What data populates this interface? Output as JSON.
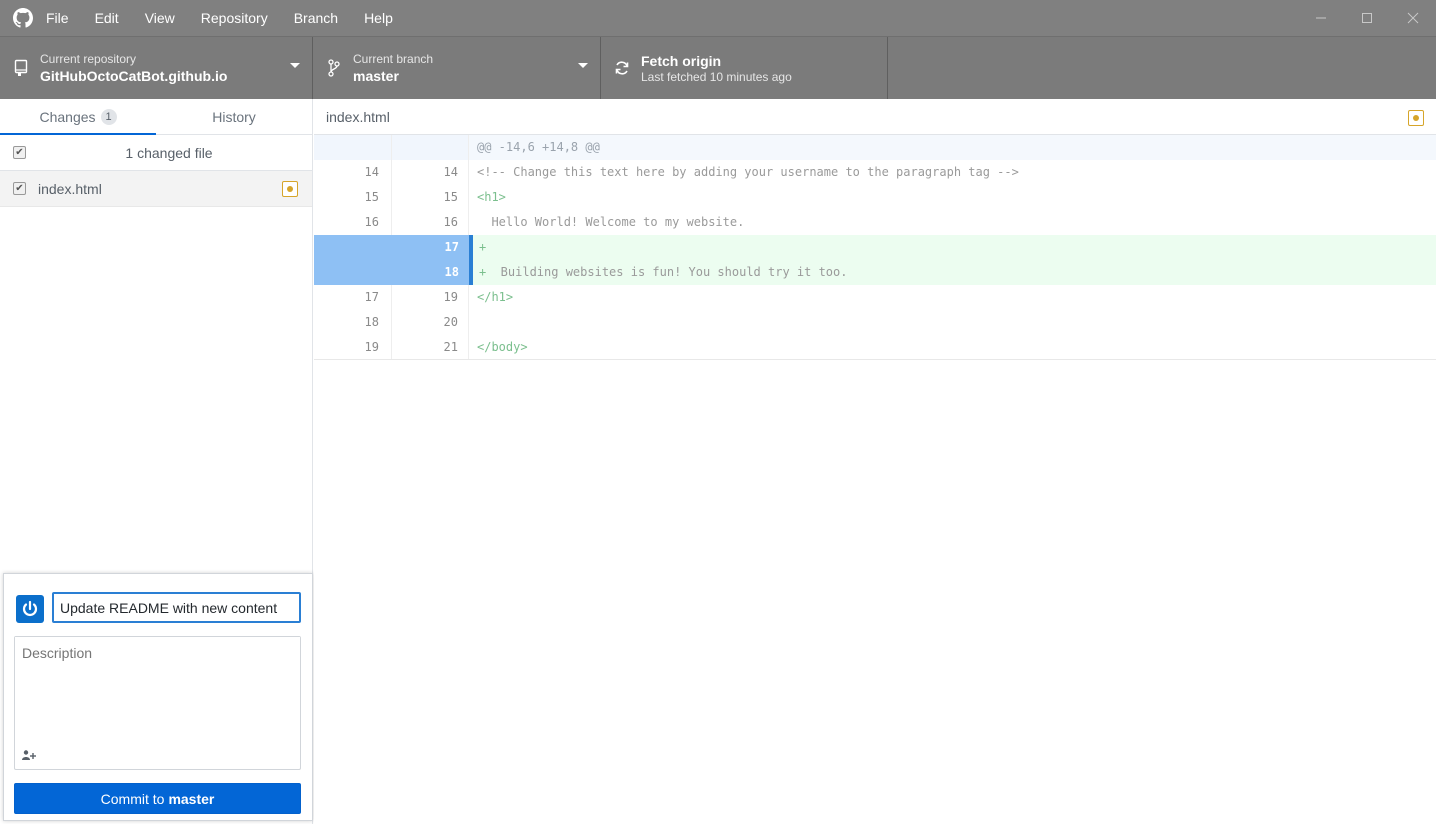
{
  "titlebar": {
    "menu": [
      "File",
      "Edit",
      "View",
      "Repository",
      "Branch",
      "Help"
    ],
    "colors": {
      "background": "#808080"
    }
  },
  "toolbar": {
    "repository": {
      "label": "Current repository",
      "value": "GitHubOctoCatBot.github.io",
      "icon": "repo-icon"
    },
    "branch": {
      "label": "Current branch",
      "value": "master",
      "icon": "branch-icon"
    },
    "fetch": {
      "title": "Fetch origin",
      "subtitle": "Last fetched 10 minutes ago",
      "icon": "sync-icon"
    }
  },
  "sidebar": {
    "tabs": {
      "changes": "Changes",
      "changes_count": "1",
      "history": "History"
    },
    "changed_files_header": "1 changed file",
    "files": [
      {
        "name": "index.html",
        "status": "modified"
      }
    ]
  },
  "commit": {
    "summary_value": "Update README with new content",
    "description_placeholder": "Description",
    "button_prefix": "Commit to",
    "button_branch": "master",
    "accent": "#0366d6"
  },
  "diff": {
    "filename": "index.html",
    "hunk_header": "@@ -14,6 +14,8 @@",
    "lines": [
      {
        "old": "14",
        "new": "14",
        "type": "context",
        "text": "<!-- Change this text here by adding your username to the paragraph tag -->"
      },
      {
        "old": "15",
        "new": "15",
        "type": "context",
        "text": "<h1>"
      },
      {
        "old": "16",
        "new": "16",
        "type": "context",
        "text": "  Hello World! Welcome to my website."
      },
      {
        "old": "",
        "new": "17",
        "type": "add",
        "text": ""
      },
      {
        "old": "",
        "new": "18",
        "type": "add",
        "text": "  Building websites is fun! You should try it too."
      },
      {
        "old": "17",
        "new": "19",
        "type": "context",
        "text": "</h1>"
      },
      {
        "old": "18",
        "new": "20",
        "type": "context",
        "text": ""
      },
      {
        "old": "19",
        "new": "21",
        "type": "context",
        "text": "</body>"
      }
    ]
  }
}
